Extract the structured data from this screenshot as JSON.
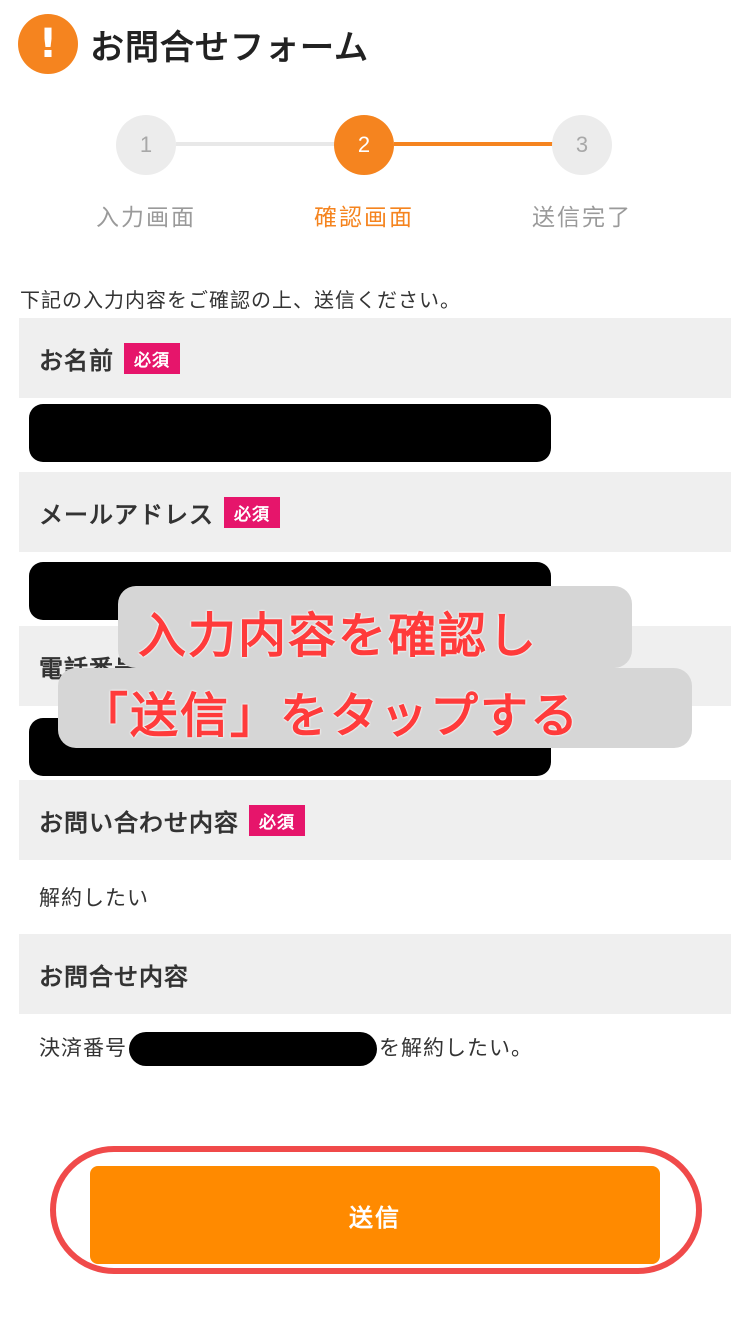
{
  "header": {
    "icon": "exclamation-icon",
    "title": "お問合せフォーム"
  },
  "steps": [
    {
      "number": "1",
      "label": "入力画面",
      "state": "inactive"
    },
    {
      "number": "2",
      "label": "確認画面",
      "state": "active"
    },
    {
      "number": "3",
      "label": "送信完了",
      "state": "inactive"
    }
  ],
  "intro": "下記の入力内容をご確認の上、送信ください。",
  "fields": {
    "name": {
      "label": "お名前",
      "required_badge": "必須"
    },
    "email": {
      "label": "メールアドレス",
      "required_badge": "必須"
    },
    "phone": {
      "label": "電話番号"
    },
    "inquiry_type": {
      "label": "お問い合わせ内容",
      "required_badge": "必須",
      "value": "解約したい"
    },
    "inquiry_detail": {
      "label": "お問合せ内容",
      "value_prefix": "決済番号",
      "value_suffix": "を解約したい。"
    }
  },
  "overlay": {
    "line1": "入力内容を確認し",
    "line2": "「送信」をタップする"
  },
  "submit": {
    "label": "送信"
  },
  "colors": {
    "accent": "#F5841F",
    "badge": "#E6156B",
    "button": "#FF8A00",
    "highlight_outline": "#F04A4A",
    "overlay_text": "#FF3B3B"
  }
}
